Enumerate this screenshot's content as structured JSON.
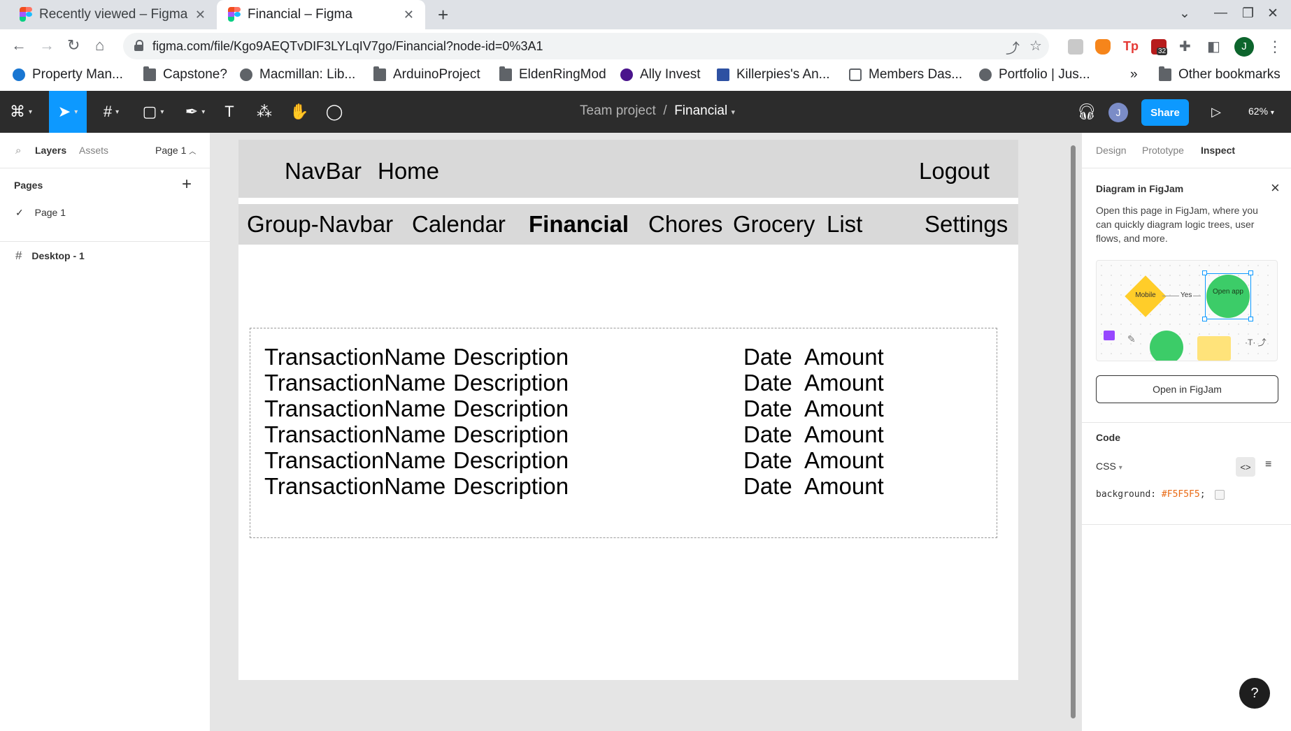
{
  "browser": {
    "tabs": [
      {
        "title": "Recently viewed – Figma",
        "active": false
      },
      {
        "title": "Financial – Figma",
        "active": true
      }
    ],
    "url": "figma.com/file/Kgo9AEQTvDIF3LYLqIV7go/Financial?node-id=0%3A1",
    "profile_initial": "J",
    "extension_badge": "32",
    "bookmarks": [
      {
        "label": "Property Man...",
        "icon": "site-icon"
      },
      {
        "label": "Capstone?",
        "icon": "folder-icon"
      },
      {
        "label": "Macmillan: Lib...",
        "icon": "globe-icon"
      },
      {
        "label": "ArduinoProject",
        "icon": "folder-icon"
      },
      {
        "label": "EldenRingMod",
        "icon": "folder-icon"
      },
      {
        "label": "Ally Invest",
        "icon": "site-icon"
      },
      {
        "label": "Killerpies's An...",
        "icon": "site-icon"
      },
      {
        "label": "Members Das...",
        "icon": "site-icon"
      },
      {
        "label": "Portfolio | Jus...",
        "icon": "globe-icon"
      }
    ],
    "bookmarks_overflow": "»",
    "other_bookmarks": "Other bookmarks"
  },
  "figma": {
    "breadcrumb": {
      "team": "Team project",
      "separator": "/",
      "file": "Financial"
    },
    "user_initial": "J",
    "share_label": "Share",
    "zoom": "62%",
    "left_panel": {
      "tabs": [
        "Layers",
        "Assets"
      ],
      "page_selector": "Page 1",
      "pages_heading": "Pages",
      "pages": [
        "Page 1"
      ],
      "layers": [
        "Desktop - 1"
      ]
    },
    "right_panel": {
      "tabs": [
        "Design",
        "Prototype",
        "Inspect"
      ],
      "banner_title": "Diagram in FigJam",
      "banner_desc": "Open this page in FigJam, where you can quickly diagram logic trees, user flows, and more.",
      "illustration": {
        "diamond": "Mobile",
        "arrow": "Yes",
        "circle": "Open app"
      },
      "open_button": "Open in FigJam",
      "code_heading": "Code",
      "code_lang": "CSS",
      "css_property": "background:",
      "css_value": "#F5F5F5",
      "css_semicolon": ";"
    },
    "help": "?"
  },
  "design": {
    "navbar": {
      "label": "NavBar",
      "home": "Home",
      "logout": "Logout"
    },
    "group_navbar": {
      "label": "Group-Navbar",
      "items": [
        "Calendar",
        "Financial",
        "Chores",
        "Grocery",
        "List",
        "Settings"
      ],
      "active": "Financial"
    },
    "transactions": {
      "rows": [
        {
          "name": "TransactionName",
          "description": "Description",
          "date": "Date",
          "amount": "Amount"
        },
        {
          "name": "TransactionName",
          "description": "Description",
          "date": "Date",
          "amount": "Amount"
        },
        {
          "name": "TransactionName",
          "description": "Description",
          "date": "Date",
          "amount": "Amount"
        },
        {
          "name": "TransactionName",
          "description": "Description",
          "date": "Date",
          "amount": "Amount"
        },
        {
          "name": "TransactionName",
          "description": "Description",
          "date": "Date",
          "amount": "Amount"
        },
        {
          "name": "TransactionName",
          "description": "Description",
          "date": "Date",
          "amount": "Amount"
        }
      ]
    }
  },
  "colors": {
    "figma_blue": "#0d99ff",
    "toolbar_bg": "#2c2c2c",
    "nav_gray": "#d9d9d9",
    "canvas_bg": "#e5e5e5"
  }
}
